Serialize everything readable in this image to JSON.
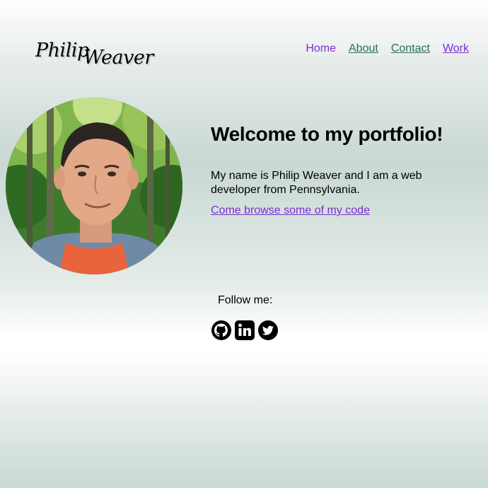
{
  "header": {
    "logo_first": "Philip",
    "logo_last": "Weaver"
  },
  "nav": {
    "items": [
      {
        "label": "Home"
      },
      {
        "label": "About"
      },
      {
        "label": "Contact"
      },
      {
        "label": "Work"
      }
    ]
  },
  "hero": {
    "title": "Welcome to my portfolio!",
    "bio": "My name is Philip Weaver and I am a web developer from Pennsylvania.",
    "link_text": "Come browse some of my code"
  },
  "social": {
    "label": "Follow me:",
    "icons": [
      "github-icon",
      "linkedin-icon",
      "twitter-icon"
    ]
  },
  "colors": {
    "link_purple": "#7b2fd0",
    "link_green": "#2c6e5c",
    "background_tint": "#c8d8d3"
  }
}
